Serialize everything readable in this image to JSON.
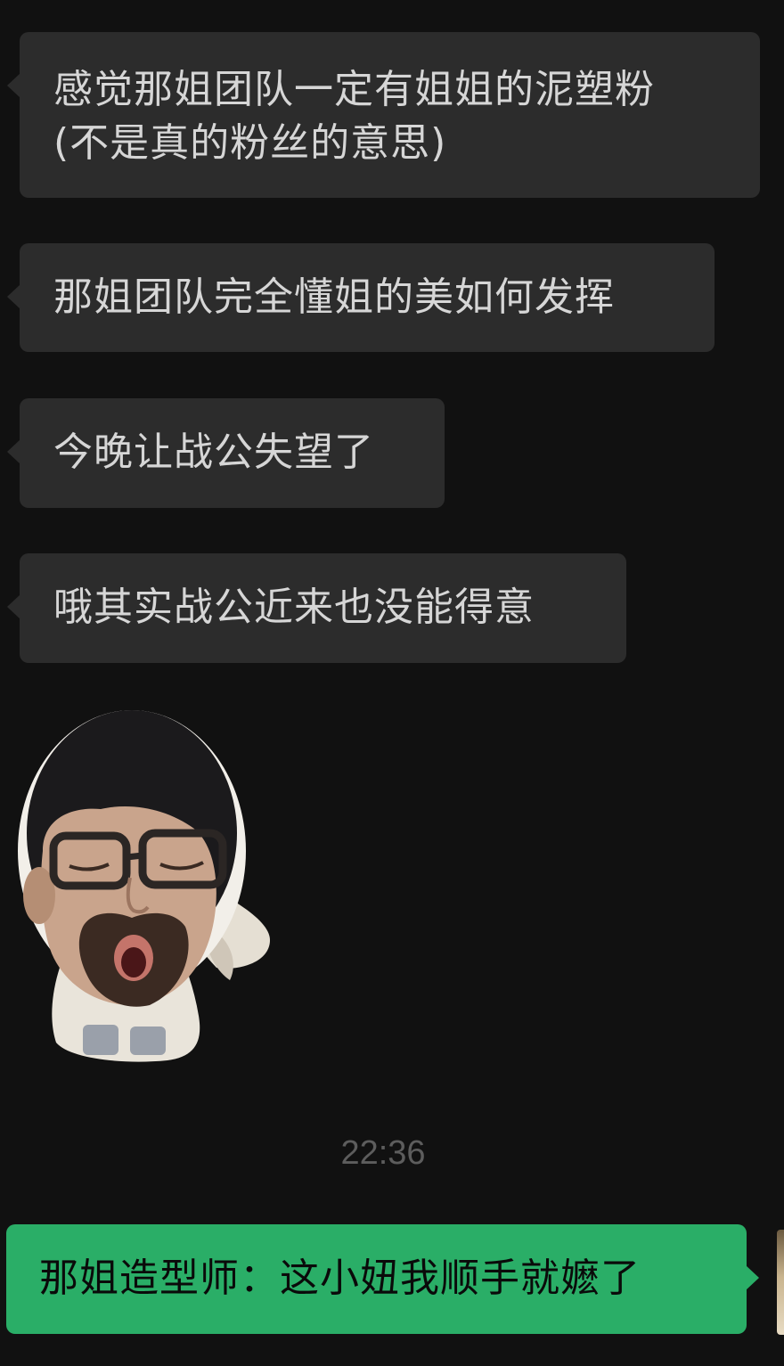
{
  "chat": {
    "messages": [
      {
        "direction": "incoming",
        "lines": [
          "感觉那姐团队一定有姐姐的泥塑粉",
          "(不是真的粉丝的意思)"
        ]
      },
      {
        "direction": "incoming",
        "lines": [
          "那姐团队完全懂姐的美如何发挥"
        ]
      },
      {
        "direction": "incoming",
        "lines": [
          "今晚让战公失望了"
        ]
      },
      {
        "direction": "incoming",
        "lines": [
          "哦其实战公近来也没能得意"
        ]
      },
      {
        "direction": "incoming",
        "type": "sticker",
        "icon": "bearded-glasses-face-sticker"
      },
      {
        "direction": "outgoing",
        "lines": [
          "那姐造型师：这小妞我顺手就嬷了"
        ]
      }
    ],
    "timestamp": "22:36"
  },
  "colors": {
    "background": "#111111",
    "incoming_bubble": "#2c2c2c",
    "outgoing_bubble": "#2aae67",
    "timestamp_text": "#5d5d5d"
  }
}
